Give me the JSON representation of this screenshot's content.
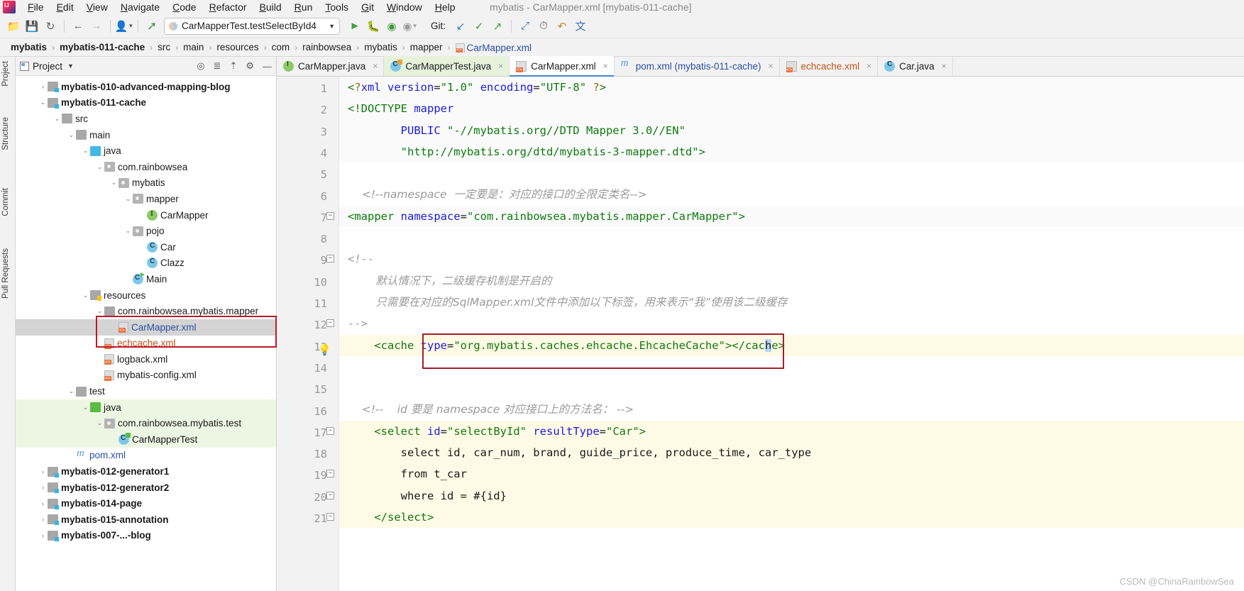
{
  "window": {
    "title": "mybatis - CarMapper.xml [mybatis-011-cache]"
  },
  "menubar": {
    "items": [
      "File",
      "Edit",
      "View",
      "Navigate",
      "Code",
      "Refactor",
      "Build",
      "Run",
      "Tools",
      "Git",
      "Window",
      "Help"
    ]
  },
  "toolbar": {
    "icons": [
      "open-folder-icon",
      "save-icon",
      "sync-icon",
      "back-arrow-icon",
      "forward-arrow-icon",
      "profile-icon",
      "build-hammer-icon"
    ],
    "run_config": {
      "label": "CarMapperTest.testSelectById4",
      "caret": "▼"
    },
    "run_icons": [
      "run-icon",
      "debug-icon",
      "run-coverage-icon",
      "more-run-icon",
      "clock-icon",
      "undo-icon",
      "translate-icon"
    ],
    "git_label": "Git:",
    "git_icons": [
      "git-update-icon",
      "git-commit-icon",
      "git-push-icon",
      "git-branch-icon"
    ]
  },
  "breadcrumbs": [
    {
      "label": "mybatis",
      "bold": true
    },
    {
      "label": "mybatis-011-cache",
      "bold": true
    },
    {
      "label": "src",
      "bold": false
    },
    {
      "label": "main",
      "bold": false
    },
    {
      "label": "resources",
      "bold": false
    },
    {
      "label": "com",
      "bold": false
    },
    {
      "label": "rainbowsea",
      "bold": false
    },
    {
      "label": "mybatis",
      "bold": false
    },
    {
      "label": "mapper",
      "bold": false
    },
    {
      "label": "CarMapper.xml",
      "bold": false,
      "link": true,
      "icon": true
    }
  ],
  "left_strip": {
    "tabs": [
      "Project",
      "Structure",
      "Commit",
      "Pull Requests"
    ]
  },
  "project_panel": {
    "title": "Project",
    "caret": "▼",
    "tool_icons": [
      "target-icon",
      "collapse-icon",
      "expand-icon",
      "gear-icon",
      "hide-icon"
    ],
    "tree": [
      {
        "indent": 1,
        "arrow": "›",
        "icon": "module",
        "label": "mybatis-010-advanced-mapping-blog",
        "style": "bold"
      },
      {
        "indent": 1,
        "arrow": "⌄",
        "icon": "module",
        "label": "mybatis-011-cache",
        "style": "bold"
      },
      {
        "indent": 2,
        "arrow": "⌄",
        "icon": "folder",
        "label": "src",
        "style": ""
      },
      {
        "indent": 3,
        "arrow": "⌄",
        "icon": "folder",
        "label": "main",
        "style": ""
      },
      {
        "indent": 4,
        "arrow": "⌄",
        "icon": "folder-blue",
        "label": "java",
        "style": ""
      },
      {
        "indent": 5,
        "arrow": "⌄",
        "icon": "pkg",
        "label": "com.rainbowsea",
        "style": ""
      },
      {
        "indent": 6,
        "arrow": "⌄",
        "icon": "pkg",
        "label": "mybatis",
        "style": ""
      },
      {
        "indent": 7,
        "arrow": "⌄",
        "icon": "pkg",
        "label": "mapper",
        "style": ""
      },
      {
        "indent": 8,
        "arrow": "",
        "icon": "iface",
        "label": "CarMapper",
        "style": ""
      },
      {
        "indent": 7,
        "arrow": "⌄",
        "icon": "pkg",
        "label": "pojo",
        "style": ""
      },
      {
        "indent": 8,
        "arrow": "",
        "icon": "cls",
        "label": "Car",
        "style": ""
      },
      {
        "indent": 8,
        "arrow": "",
        "icon": "cls",
        "label": "Clazz",
        "style": ""
      },
      {
        "indent": 7,
        "arrow": "",
        "icon": "clsrun",
        "label": "Main",
        "style": ""
      },
      {
        "indent": 4,
        "arrow": "⌄",
        "icon": "folder-res",
        "label": "resources",
        "style": ""
      },
      {
        "indent": 5,
        "arrow": "⌄",
        "icon": "folder",
        "label": "com.rainbowsea.mybatis.mapper",
        "style": ""
      },
      {
        "indent": 6,
        "arrow": "",
        "icon": "xml",
        "label": "CarMapper.xml",
        "style": "blue",
        "selected": true
      },
      {
        "indent": 5,
        "arrow": "",
        "icon": "xml",
        "label": "echcache.xml",
        "style": "orange"
      },
      {
        "indent": 5,
        "arrow": "",
        "icon": "xml",
        "label": "logback.xml",
        "style": ""
      },
      {
        "indent": 5,
        "arrow": "",
        "icon": "xml",
        "label": "mybatis-config.xml",
        "style": ""
      },
      {
        "indent": 3,
        "arrow": "⌄",
        "icon": "folder",
        "label": "test",
        "style": ""
      },
      {
        "indent": 4,
        "arrow": "⌄",
        "icon": "folder-green",
        "label": "java",
        "style": "",
        "green": true
      },
      {
        "indent": 5,
        "arrow": "⌄",
        "icon": "pkg",
        "label": "com.rainbowsea.mybatis.test",
        "style": "",
        "green": true
      },
      {
        "indent": 6,
        "arrow": "",
        "icon": "clstest",
        "label": "CarMapperTest",
        "style": "",
        "green": true
      },
      {
        "indent": 3,
        "arrow": "",
        "icon": "maven",
        "label": "pom.xml",
        "style": "blue"
      },
      {
        "indent": 1,
        "arrow": "›",
        "icon": "module",
        "label": "mybatis-012-generator1",
        "style": "bold"
      },
      {
        "indent": 1,
        "arrow": "›",
        "icon": "module",
        "label": "mybatis-012-generator2",
        "style": "bold"
      },
      {
        "indent": 1,
        "arrow": "›",
        "icon": "module",
        "label": "mybatis-014-page",
        "style": "bold"
      },
      {
        "indent": 1,
        "arrow": "›",
        "icon": "module",
        "label": "mybatis-015-annotation",
        "style": "bold"
      },
      {
        "indent": 1,
        "arrow": "›",
        "icon": "module",
        "label": "mybatis-007-...-blog",
        "style": "bold"
      }
    ]
  },
  "editor_tabs": [
    {
      "label": "CarMapper.java",
      "icon": "interface-icon",
      "state": "normal",
      "close": "×"
    },
    {
      "label": "CarMapperTest.java",
      "icon": "test-class-icon",
      "state": "green",
      "close": "×"
    },
    {
      "label": "CarMapper.xml",
      "icon": "xml-file-icon",
      "state": "active",
      "close": "×"
    },
    {
      "label": "pom.xml (mybatis-011-cache)",
      "icon": "maven-icon",
      "state": "blue",
      "close": "×"
    },
    {
      "label": "echcache.xml",
      "icon": "xml-file-icon",
      "state": "orange",
      "close": "×"
    },
    {
      "label": "Car.java",
      "icon": "class-icon",
      "state": "normal",
      "close": "×"
    }
  ],
  "code": {
    "lines": [
      {
        "n": "1",
        "segments": [
          {
            "t": "<",
            "c": "t-tag"
          },
          {
            "t": "?",
            "c": "t-pi"
          },
          {
            "t": "xml ",
            "c": "t-kw"
          },
          {
            "t": "version",
            "c": "t-kw"
          },
          {
            "t": "=",
            "c": "t-punct"
          },
          {
            "t": "\"1.0\"",
            "c": "t-val"
          },
          {
            "t": " ",
            "c": "t-punct"
          },
          {
            "t": "encoding",
            "c": "t-kw"
          },
          {
            "t": "=",
            "c": "t-punct"
          },
          {
            "t": "\"UTF-8\"",
            "c": "t-val"
          },
          {
            "t": " ",
            "c": "t-punct"
          },
          {
            "t": "?",
            "c": "t-pi"
          },
          {
            "t": ">",
            "c": "t-tag"
          }
        ],
        "bg": "hl-soft"
      },
      {
        "n": "2",
        "segments": [
          {
            "t": "<!DOCTYPE ",
            "c": "t-doct"
          },
          {
            "t": "mapper",
            "c": "t-kw"
          }
        ],
        "bg": "hl-soft"
      },
      {
        "n": "3",
        "segments": [
          {
            "t": "        PUBLIC ",
            "c": "t-kw"
          },
          {
            "t": "\"-//mybatis.org//DTD Mapper 3.0//EN\"",
            "c": "t-val"
          }
        ],
        "bg": "hl-soft"
      },
      {
        "n": "4",
        "segments": [
          {
            "t": "        \"http://mybatis.org/dtd/mybatis-3-mapper.dtd\"",
            "c": "t-val"
          },
          {
            "t": ">",
            "c": "t-tag"
          }
        ],
        "bg": "hl-soft"
      },
      {
        "n": "5",
        "segments": [],
        "bg": ""
      },
      {
        "n": "6",
        "segments": [
          {
            "t": "    <!--namespace  一定要是：对应的接口的全限定类名-->",
            "c": "t-cmt"
          }
        ],
        "bg": ""
      },
      {
        "n": "7",
        "segments": [
          {
            "t": "<mapper ",
            "c": "t-tag"
          },
          {
            "t": "namespace",
            "c": "t-attr"
          },
          {
            "t": "=",
            "c": "t-punct"
          },
          {
            "t": "\"com.rainbowsea.mybatis.mapper.CarMapper\"",
            "c": "t-val"
          },
          {
            "t": ">",
            "c": "t-tag"
          }
        ],
        "bg": "hl-soft",
        "fold": true
      },
      {
        "n": "8",
        "segments": [],
        "bg": ""
      },
      {
        "n": "9",
        "segments": [
          {
            "t": "<!--",
            "c": "t-cmt"
          }
        ],
        "bg": "",
        "fold": true
      },
      {
        "n": "10",
        "segments": [
          {
            "t": "        默认情况下，二级缓存机制是开启的",
            "c": "t-cmt"
          }
        ],
        "bg": ""
      },
      {
        "n": "11",
        "segments": [
          {
            "t": "        只需要在对应的SqlMapper.xml文件中添加以下标签，用来表示“我”使用该二级缓存",
            "c": "t-cmt"
          }
        ],
        "bg": ""
      },
      {
        "n": "12",
        "segments": [
          {
            "t": "-->",
            "c": "t-cmt"
          }
        ],
        "bg": "",
        "fold": true
      },
      {
        "n": "13",
        "segments": [
          {
            "t": "    <cache ",
            "c": "t-tag"
          },
          {
            "t": "type",
            "c": "t-attr"
          },
          {
            "t": "=",
            "c": "t-punct"
          },
          {
            "t": "\"org.mybatis.caches.ehcache.EhcacheCache\"",
            "c": "t-val"
          },
          {
            "t": ">",
            "c": "t-tag"
          },
          {
            "t": "</cac",
            "c": "t-tag"
          },
          {
            "t": "h",
            "c": "t-sel"
          },
          {
            "t": "e>",
            "c": "t-tag"
          }
        ],
        "bg": "hl-row",
        "bulb": true
      },
      {
        "n": "14",
        "segments": [],
        "bg": ""
      },
      {
        "n": "15",
        "segments": [],
        "bg": ""
      },
      {
        "n": "16",
        "segments": [
          {
            "t": "    <!--    id 要是 namespace 对应接口上的方法名： -->",
            "c": "t-cmt"
          }
        ],
        "bg": ""
      },
      {
        "n": "17",
        "segments": [
          {
            "t": "    <select ",
            "c": "t-tag"
          },
          {
            "t": "id",
            "c": "t-attr"
          },
          {
            "t": "=",
            "c": "t-punct"
          },
          {
            "t": "\"selectById\"",
            "c": "t-val"
          },
          {
            "t": " ",
            "c": "t-punct"
          },
          {
            "t": "resultType",
            "c": "t-attr"
          },
          {
            "t": "=",
            "c": "t-punct"
          },
          {
            "t": "\"Car\"",
            "c": "t-val"
          },
          {
            "t": ">",
            "c": "t-tag"
          }
        ],
        "bg": "hl-row",
        "fold": true
      },
      {
        "n": "18",
        "segments": [
          {
            "t": "        select id, car_num, brand, guide_price, produce_time, car_type",
            "c": "t-punct"
          }
        ],
        "bg": "hl-row"
      },
      {
        "n": "19",
        "segments": [
          {
            "t": "        from t_car",
            "c": "t-punct"
          }
        ],
        "bg": "hl-row",
        "fold": true
      },
      {
        "n": "20",
        "segments": [
          {
            "t": "        where id = #{id}",
            "c": "t-punct"
          }
        ],
        "bg": "hl-row",
        "fold": true
      },
      {
        "n": "21",
        "segments": [
          {
            "t": "    </select>",
            "c": "t-tag"
          }
        ],
        "bg": "hl-row",
        "fold": true
      }
    ]
  },
  "watermark": "CSDN @ChinaRainbowSea"
}
